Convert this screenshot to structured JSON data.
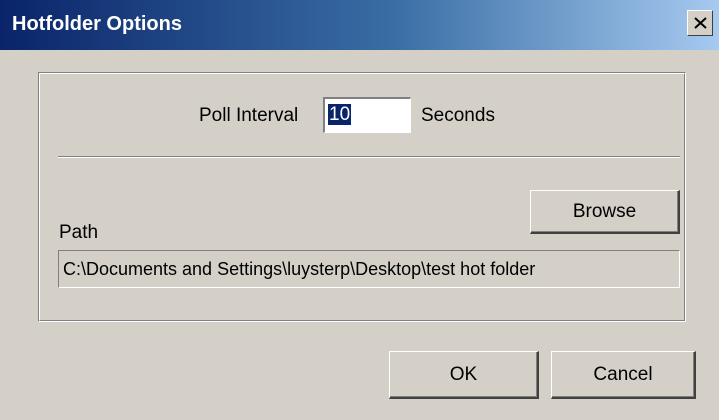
{
  "window": {
    "title": "Hotfolder Options",
    "close_icon": "close-icon"
  },
  "poll": {
    "label": "Poll Interval",
    "value": "10",
    "unit": "Seconds"
  },
  "path": {
    "label": "Path",
    "value": "C:\\Documents and Settings\\luysterp\\Desktop\\test hot folder",
    "browse_label": "Browse"
  },
  "footer": {
    "ok_label": "OK",
    "cancel_label": "Cancel"
  },
  "colors": {
    "title_start": "#0a246a",
    "title_end": "#a6caf0",
    "face": "#d4d0c8",
    "selection": "#0a246a"
  }
}
